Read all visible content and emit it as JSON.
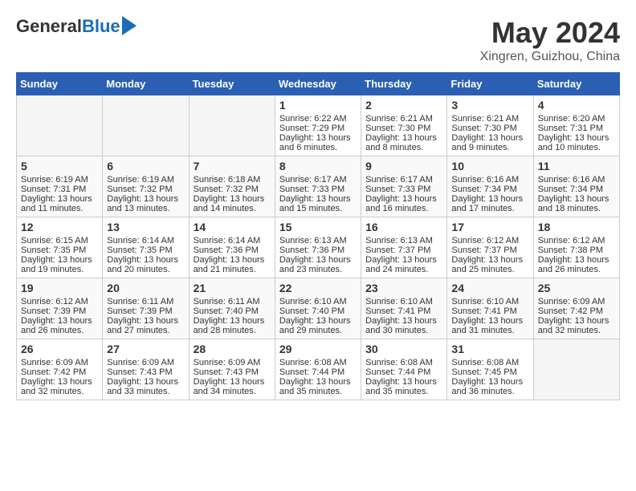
{
  "header": {
    "logo_general": "General",
    "logo_blue": "Blue",
    "month_title": "May 2024",
    "location": "Xingren, Guizhou, China"
  },
  "days_of_week": [
    "Sunday",
    "Monday",
    "Tuesday",
    "Wednesday",
    "Thursday",
    "Friday",
    "Saturday"
  ],
  "weeks": [
    [
      {
        "day": "",
        "empty": true
      },
      {
        "day": "",
        "empty": true
      },
      {
        "day": "",
        "empty": true
      },
      {
        "day": "1",
        "sunrise": "6:22 AM",
        "sunset": "7:29 PM",
        "daylight": "13 hours and 6 minutes."
      },
      {
        "day": "2",
        "sunrise": "6:21 AM",
        "sunset": "7:30 PM",
        "daylight": "13 hours and 8 minutes."
      },
      {
        "day": "3",
        "sunrise": "6:21 AM",
        "sunset": "7:30 PM",
        "daylight": "13 hours and 9 minutes."
      },
      {
        "day": "4",
        "sunrise": "6:20 AM",
        "sunset": "7:31 PM",
        "daylight": "13 hours and 10 minutes."
      }
    ],
    [
      {
        "day": "5",
        "sunrise": "6:19 AM",
        "sunset": "7:31 PM",
        "daylight": "13 hours and 11 minutes."
      },
      {
        "day": "6",
        "sunrise": "6:19 AM",
        "sunset": "7:32 PM",
        "daylight": "13 hours and 13 minutes."
      },
      {
        "day": "7",
        "sunrise": "6:18 AM",
        "sunset": "7:32 PM",
        "daylight": "13 hours and 14 minutes."
      },
      {
        "day": "8",
        "sunrise": "6:17 AM",
        "sunset": "7:33 PM",
        "daylight": "13 hours and 15 minutes."
      },
      {
        "day": "9",
        "sunrise": "6:17 AM",
        "sunset": "7:33 PM",
        "daylight": "13 hours and 16 minutes."
      },
      {
        "day": "10",
        "sunrise": "6:16 AM",
        "sunset": "7:34 PM",
        "daylight": "13 hours and 17 minutes."
      },
      {
        "day": "11",
        "sunrise": "6:16 AM",
        "sunset": "7:34 PM",
        "daylight": "13 hours and 18 minutes."
      }
    ],
    [
      {
        "day": "12",
        "sunrise": "6:15 AM",
        "sunset": "7:35 PM",
        "daylight": "13 hours and 19 minutes."
      },
      {
        "day": "13",
        "sunrise": "6:14 AM",
        "sunset": "7:35 PM",
        "daylight": "13 hours and 20 minutes."
      },
      {
        "day": "14",
        "sunrise": "6:14 AM",
        "sunset": "7:36 PM",
        "daylight": "13 hours and 21 minutes."
      },
      {
        "day": "15",
        "sunrise": "6:13 AM",
        "sunset": "7:36 PM",
        "daylight": "13 hours and 23 minutes."
      },
      {
        "day": "16",
        "sunrise": "6:13 AM",
        "sunset": "7:37 PM",
        "daylight": "13 hours and 24 minutes."
      },
      {
        "day": "17",
        "sunrise": "6:12 AM",
        "sunset": "7:37 PM",
        "daylight": "13 hours and 25 minutes."
      },
      {
        "day": "18",
        "sunrise": "6:12 AM",
        "sunset": "7:38 PM",
        "daylight": "13 hours and 26 minutes."
      }
    ],
    [
      {
        "day": "19",
        "sunrise": "6:12 AM",
        "sunset": "7:39 PM",
        "daylight": "13 hours and 26 minutes."
      },
      {
        "day": "20",
        "sunrise": "6:11 AM",
        "sunset": "7:39 PM",
        "daylight": "13 hours and 27 minutes."
      },
      {
        "day": "21",
        "sunrise": "6:11 AM",
        "sunset": "7:40 PM",
        "daylight": "13 hours and 28 minutes."
      },
      {
        "day": "22",
        "sunrise": "6:10 AM",
        "sunset": "7:40 PM",
        "daylight": "13 hours and 29 minutes."
      },
      {
        "day": "23",
        "sunrise": "6:10 AM",
        "sunset": "7:41 PM",
        "daylight": "13 hours and 30 minutes."
      },
      {
        "day": "24",
        "sunrise": "6:10 AM",
        "sunset": "7:41 PM",
        "daylight": "13 hours and 31 minutes."
      },
      {
        "day": "25",
        "sunrise": "6:09 AM",
        "sunset": "7:42 PM",
        "daylight": "13 hours and 32 minutes."
      }
    ],
    [
      {
        "day": "26",
        "sunrise": "6:09 AM",
        "sunset": "7:42 PM",
        "daylight": "13 hours and 32 minutes."
      },
      {
        "day": "27",
        "sunrise": "6:09 AM",
        "sunset": "7:43 PM",
        "daylight": "13 hours and 33 minutes."
      },
      {
        "day": "28",
        "sunrise": "6:09 AM",
        "sunset": "7:43 PM",
        "daylight": "13 hours and 34 minutes."
      },
      {
        "day": "29",
        "sunrise": "6:08 AM",
        "sunset": "7:44 PM",
        "daylight": "13 hours and 35 minutes."
      },
      {
        "day": "30",
        "sunrise": "6:08 AM",
        "sunset": "7:44 PM",
        "daylight": "13 hours and 35 minutes."
      },
      {
        "day": "31",
        "sunrise": "6:08 AM",
        "sunset": "7:45 PM",
        "daylight": "13 hours and 36 minutes."
      },
      {
        "day": "",
        "empty": true
      }
    ]
  ]
}
